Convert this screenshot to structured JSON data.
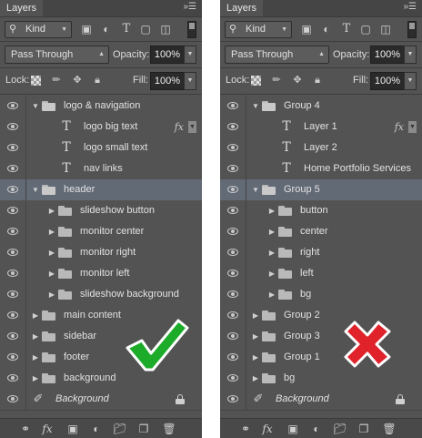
{
  "colors": {
    "panel_bg": "#535353",
    "selected_row": "#626a76",
    "check_green": "#1dab2a",
    "cross_red": "#e0222b"
  },
  "left": {
    "tab_title": "Layers",
    "filter": {
      "kind_label": "Kind"
    },
    "blend_mode": "Pass Through",
    "opacity_label": "Opacity:",
    "opacity_value": "100%",
    "lock_label": "Lock:",
    "fill_label": "Fill:",
    "fill_value": "100%",
    "layers": [
      {
        "name": "logo & navigation",
        "type": "group-open",
        "indent": 0
      },
      {
        "name": "logo big text",
        "type": "text",
        "indent": 1,
        "fx": "fx"
      },
      {
        "name": "logo small text",
        "type": "text",
        "indent": 1
      },
      {
        "name": "nav links",
        "type": "text",
        "indent": 1
      },
      {
        "name": "header",
        "type": "group-open",
        "indent": 0,
        "selected": true
      },
      {
        "name": "slideshow button",
        "type": "group",
        "indent": 1
      },
      {
        "name": "monitor center",
        "type": "group",
        "indent": 1
      },
      {
        "name": "monitor right",
        "type": "group",
        "indent": 1
      },
      {
        "name": "monitor left",
        "type": "group",
        "indent": 1
      },
      {
        "name": "slideshow background",
        "type": "group",
        "indent": 1
      },
      {
        "name": "main content",
        "type": "group",
        "indent": 0
      },
      {
        "name": "sidebar",
        "type": "group",
        "indent": 0
      },
      {
        "name": "footer",
        "type": "group",
        "indent": 0
      },
      {
        "name": "background",
        "type": "group",
        "indent": 0
      },
      {
        "name": "Background",
        "type": "background",
        "indent": 0,
        "locked": true
      }
    ],
    "verdict": "check-mark-icon"
  },
  "right": {
    "tab_title": "Layers",
    "filter": {
      "kind_label": "Kind"
    },
    "blend_mode": "Pass Through",
    "opacity_label": "Opacity:",
    "opacity_value": "100%",
    "lock_label": "Lock:",
    "fill_label": "Fill:",
    "fill_value": "100%",
    "layers": [
      {
        "name": "Group 4",
        "type": "group-open",
        "indent": 0
      },
      {
        "name": "Layer 1",
        "type": "text",
        "indent": 1,
        "fx": "fx"
      },
      {
        "name": "Layer 2",
        "type": "text",
        "indent": 1
      },
      {
        "name": "Home Portfolio Services",
        "type": "text",
        "indent": 1
      },
      {
        "name": "Group 5",
        "type": "group-open",
        "indent": 0,
        "selected": true
      },
      {
        "name": "button",
        "type": "group",
        "indent": 1
      },
      {
        "name": "center",
        "type": "group",
        "indent": 1
      },
      {
        "name": "right",
        "type": "group",
        "indent": 1
      },
      {
        "name": "left",
        "type": "group",
        "indent": 1
      },
      {
        "name": "bg",
        "type": "group",
        "indent": 1
      },
      {
        "name": "Group 2",
        "type": "group",
        "indent": 0
      },
      {
        "name": "Group 3",
        "type": "group",
        "indent": 0
      },
      {
        "name": "Group 1",
        "type": "group",
        "indent": 0
      },
      {
        "name": "bg",
        "type": "group",
        "indent": 0
      },
      {
        "name": "Background",
        "type": "background",
        "indent": 0,
        "locked": true
      }
    ],
    "verdict": "cross-mark-icon"
  },
  "icons": {
    "filter": [
      "image-filter-icon",
      "adjustment-filter-icon",
      "type-filter-icon",
      "shape-filter-icon",
      "smart-object-filter-icon"
    ],
    "lock": [
      "lock-transparent-icon",
      "lock-image-icon",
      "lock-position-icon",
      "lock-all-icon"
    ],
    "bottom": [
      "link-layers-icon",
      "add-style-icon",
      "add-mask-icon",
      "new-adjustment-icon",
      "new-group-icon",
      "new-layer-icon",
      "delete-layer-icon"
    ]
  }
}
